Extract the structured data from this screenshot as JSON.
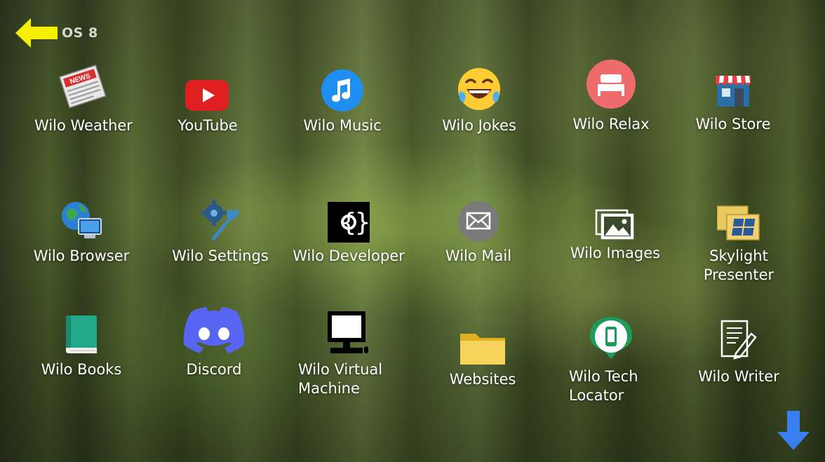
{
  "header": {
    "back_label": "OS 8"
  },
  "apps": [
    {
      "label": "Wilo Weather",
      "icon": "newspaper-icon"
    },
    {
      "label": "YouTube",
      "icon": "youtube-icon"
    },
    {
      "label": "Wilo Music",
      "icon": "music-note-icon"
    },
    {
      "label": "Wilo Jokes",
      "icon": "laughing-emoji-icon"
    },
    {
      "label": "Wilo Relax",
      "icon": "bed-icon"
    },
    {
      "label": "Wilo Store",
      "icon": "store-icon"
    },
    {
      "label": "Wilo Browser",
      "icon": "globe-computer-icon"
    },
    {
      "label": "Wilo Settings",
      "icon": "wrench-gear-icon"
    },
    {
      "label": "Wilo Developer",
      "icon": "code-braces-icon"
    },
    {
      "label": "Wilo Mail",
      "icon": "envelope-icon"
    },
    {
      "label": "Wilo Images",
      "icon": "images-icon"
    },
    {
      "label": "Skylight Presenter",
      "icon": "presenter-windows-icon"
    },
    {
      "label": "Wilo Books",
      "icon": "book-icon"
    },
    {
      "label": "Discord",
      "icon": "discord-icon"
    },
    {
      "label": "Wilo Virtual Machine",
      "icon": "monitor-icon"
    },
    {
      "label": "Websites",
      "icon": "folder-icon"
    },
    {
      "label": "Wilo Tech Locator",
      "icon": "phone-pin-icon"
    },
    {
      "label": "Wilo Writer",
      "icon": "document-pen-icon"
    }
  ],
  "nav": {
    "scroll_icon": "arrow-down-icon",
    "back_icon": "arrow-left-icon"
  }
}
